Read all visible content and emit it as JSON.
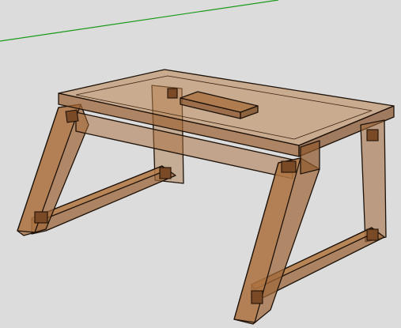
{
  "viewport": {
    "background": "#dcdcdc",
    "axis_color": "#1a9a1a",
    "wood_fill": "#a0683a",
    "wood_dark": "#7a4a26",
    "wood_light": "#c8925e",
    "edge_color": "#1e1208"
  },
  "model": {
    "object": "x-frame-bench",
    "parts": [
      "tabletop",
      "top-slot",
      "apron-front",
      "apron-back",
      "leg-left-front",
      "leg-left-back",
      "leg-right-front",
      "leg-right-back",
      "stretcher-left",
      "stretcher-right",
      "peg-left-top",
      "peg-left-bottom",
      "peg-right-top",
      "peg-right-bottom",
      "peg-back-left",
      "peg-back-right"
    ],
    "render_style": "x-ray-transparent"
  }
}
